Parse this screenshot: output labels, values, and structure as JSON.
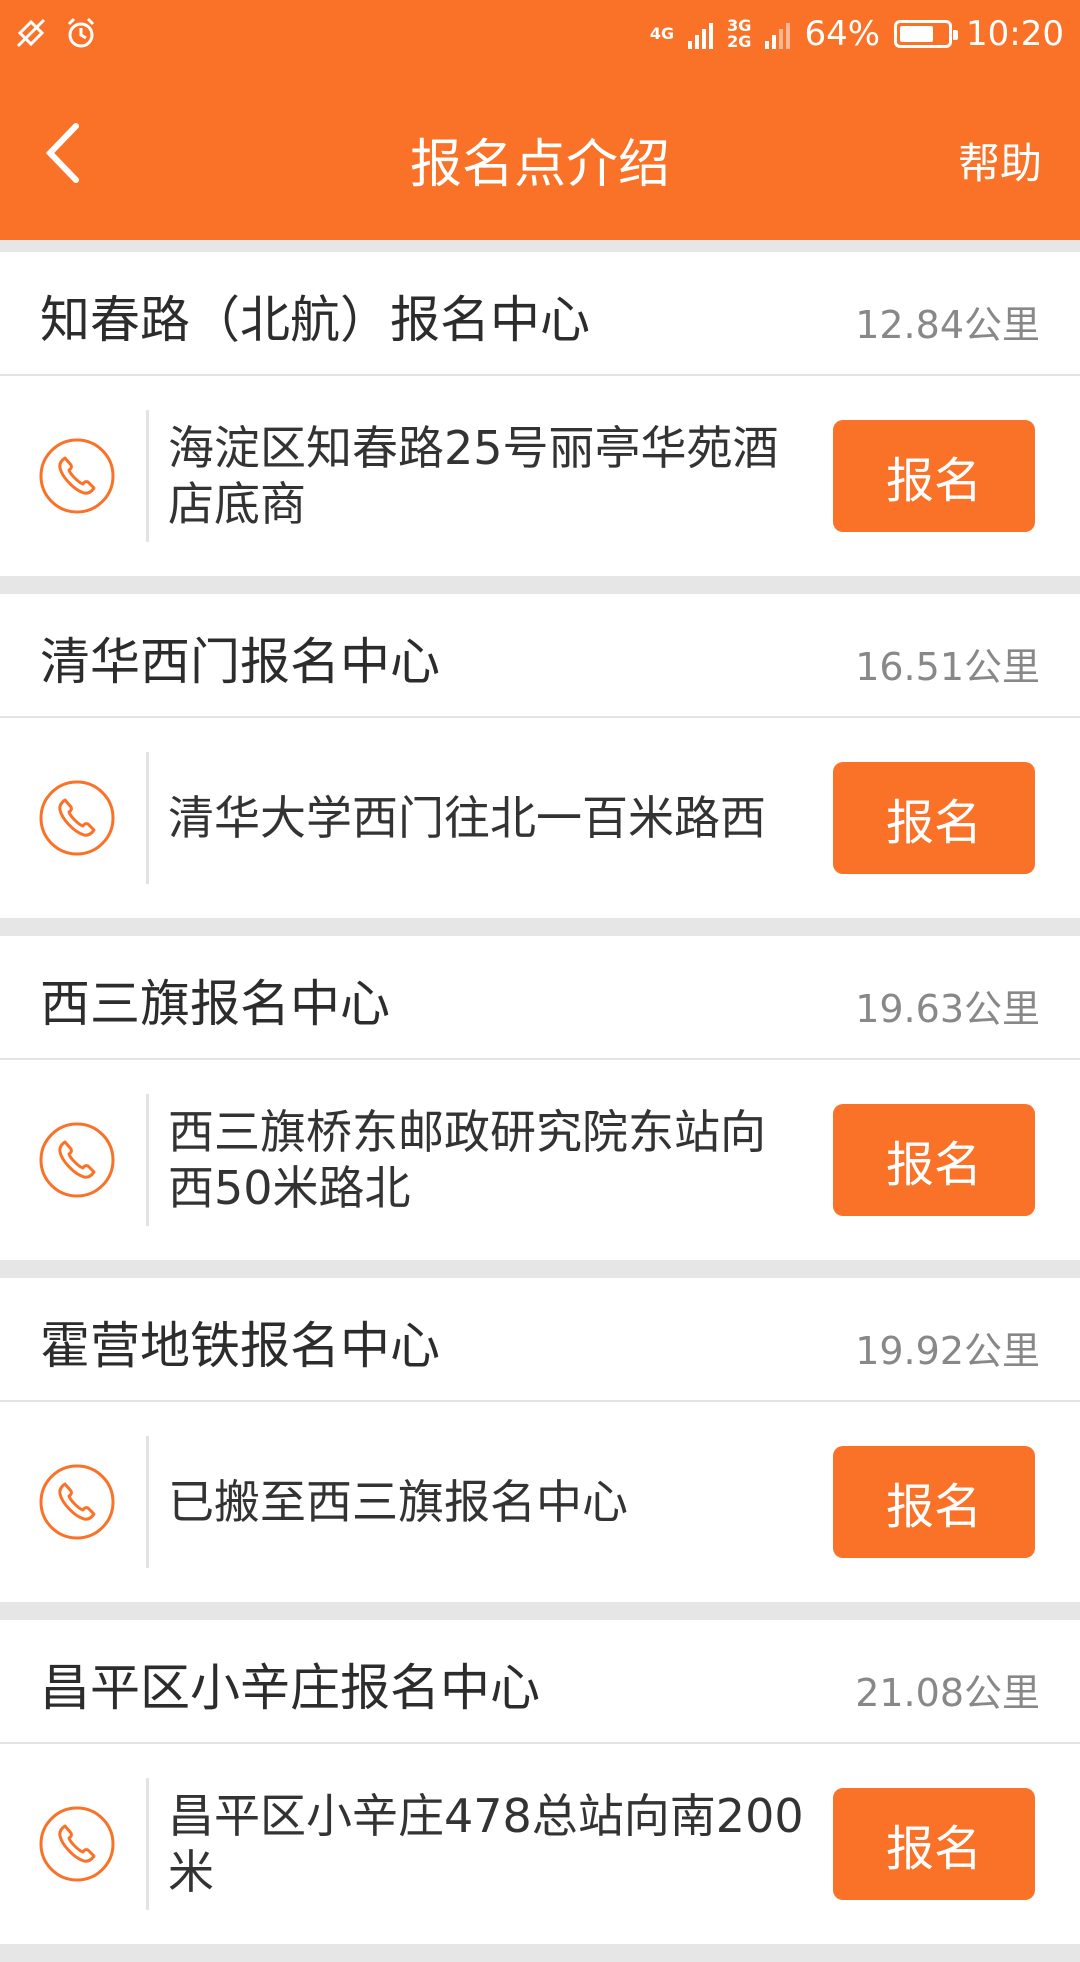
{
  "status_bar": {
    "network_1": "4G",
    "network_2": "3G",
    "network_3": "2G",
    "battery": "64%",
    "time": "10:20",
    "icons": [
      "signal-off-icon",
      "alarm-icon",
      "battery-icon"
    ]
  },
  "header": {
    "title": "报名点介绍",
    "help": "帮助",
    "back_icon": "chevron-left-icon",
    "color": "#fa7228"
  },
  "centers": [
    {
      "name": "知春路（北航）报名中心",
      "distance": "12.84公里",
      "address_lines": [
        "海淀区知春路25号丽亭华苑酒",
        "店底商"
      ],
      "button": "报名"
    },
    {
      "name": "清华西门报名中心",
      "distance": "16.51公里",
      "address_lines": [
        "清华大学西门往北一百米路西",
        ""
      ],
      "button": "报名"
    },
    {
      "name": "西三旗报名中心",
      "distance": "19.63公里",
      "address_lines": [
        "西三旗桥东邮政研究院东站向",
        "西50米路北"
      ],
      "button": "报名"
    },
    {
      "name": "霍营地铁报名中心",
      "distance": "19.92公里",
      "address_lines": [
        "已搬至西三旗报名中心",
        ""
      ],
      "button": "报名"
    },
    {
      "name": "昌平区小辛庄报名中心",
      "distance": "21.08公里",
      "address_lines": [
        "昌平区小辛庄478总站向南200",
        "米"
      ],
      "button": "报名"
    }
  ]
}
